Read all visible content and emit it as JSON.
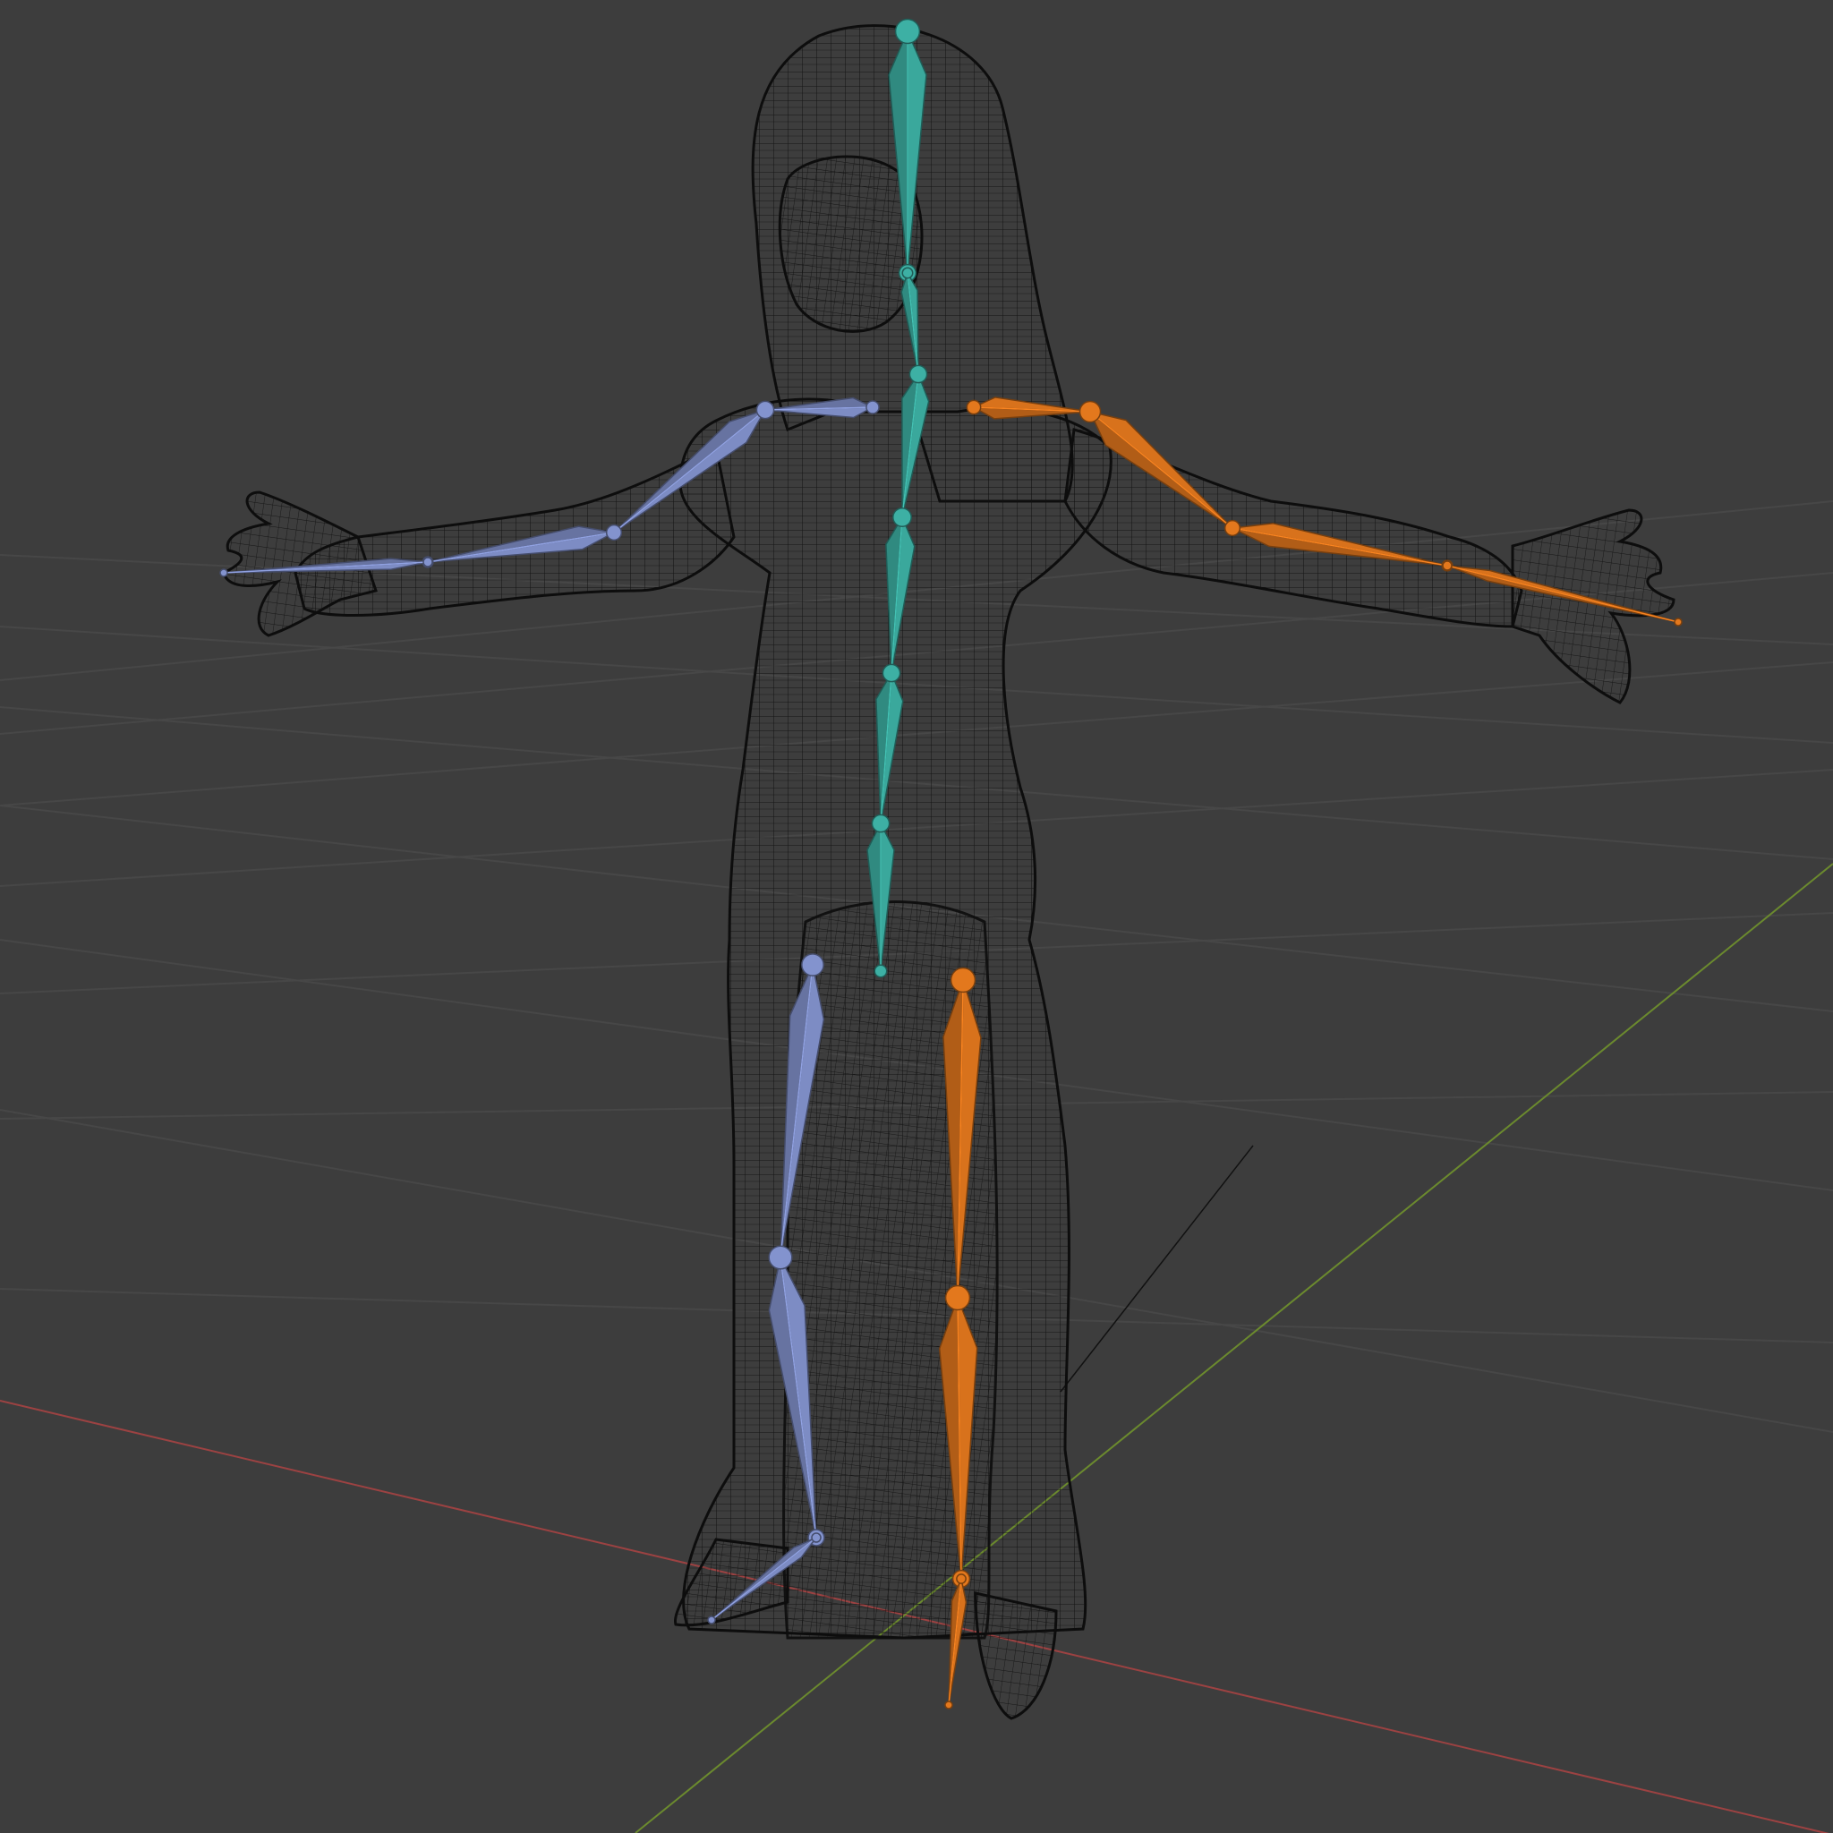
{
  "viewport": {
    "editor": "3D Viewport",
    "shading": "wireframe",
    "background_color": "#3d3d3d",
    "grid_color": "#4a4a4a",
    "axis_x_color": "#9c4242",
    "axis_y_color": "#6b8a2e"
  },
  "scene": {
    "mesh": {
      "type": "character-mesh",
      "display": "wireframe",
      "wire_color": "#111111"
    },
    "armature": {
      "display": "octahedral",
      "bone_groups": [
        {
          "name": "center",
          "color": "#3aa89c"
        },
        {
          "name": "left",
          "color": "#7d8cc4"
        },
        {
          "name": "right",
          "color": "#d8721c"
        }
      ],
      "bones": [
        {
          "group": "center",
          "label": "head"
        },
        {
          "group": "center",
          "label": "neck"
        },
        {
          "group": "center",
          "label": "spine-3"
        },
        {
          "group": "center",
          "label": "spine-2"
        },
        {
          "group": "center",
          "label": "spine-1"
        },
        {
          "group": "center",
          "label": "hips"
        },
        {
          "group": "left",
          "label": "clavicle"
        },
        {
          "group": "left",
          "label": "upper-arm"
        },
        {
          "group": "left",
          "label": "forearm"
        },
        {
          "group": "left",
          "label": "hand"
        },
        {
          "group": "left",
          "label": "thigh"
        },
        {
          "group": "left",
          "label": "shin"
        },
        {
          "group": "left",
          "label": "foot"
        },
        {
          "group": "right",
          "label": "clavicle"
        },
        {
          "group": "right",
          "label": "upper-arm"
        },
        {
          "group": "right",
          "label": "forearm"
        },
        {
          "group": "right",
          "label": "hand"
        },
        {
          "group": "right",
          "label": "thigh"
        },
        {
          "group": "right",
          "label": "shin"
        },
        {
          "group": "right",
          "label": "foot"
        }
      ]
    }
  }
}
